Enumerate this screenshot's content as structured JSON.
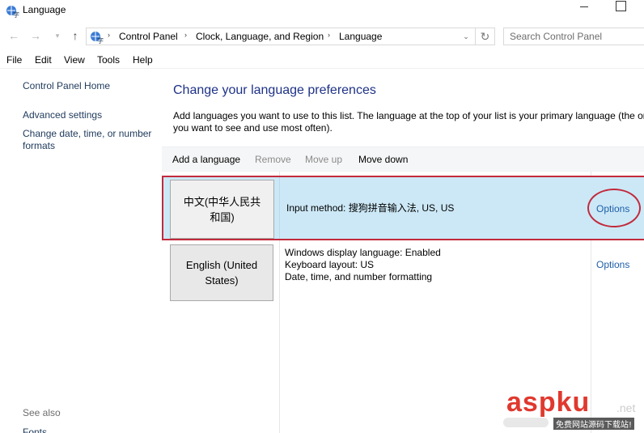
{
  "window": {
    "title": "Language"
  },
  "nav": {
    "back": "←",
    "forward": "→",
    "recent": "▾",
    "up": "↑",
    "breadcrumbs": [
      "Control Panel",
      "Clock, Language, and Region",
      "Language"
    ],
    "separator": "›",
    "dropdown": "⌄",
    "refresh": "↻",
    "search_placeholder": "Search Control Panel"
  },
  "menu": [
    "File",
    "Edit",
    "View",
    "Tools",
    "Help"
  ],
  "sidebar": {
    "home": "Control Panel Home",
    "advanced": "Advanced settings",
    "datetime_line1": "Change date, time, or number",
    "datetime_line2": "formats",
    "see_also": "See also",
    "fonts": "Fonts"
  },
  "main": {
    "heading": "Change your language preferences",
    "desc_line1": "Add languages you want to use to this list. The language at the top of your list is your primary language (the one",
    "desc_line2": "you want to see and use most often)."
  },
  "toolbar": {
    "add": "Add a language",
    "remove": "Remove",
    "move_up": "Move up",
    "move_down": "Move down"
  },
  "languages": [
    {
      "name_line1": "中文(中华人民共",
      "name_line2": "和国)",
      "info": [
        "Input method: 搜狗拼音输入法, US, US"
      ],
      "options": "Options",
      "selected": true
    },
    {
      "name_line1": "English (United",
      "name_line2": "States)",
      "info": [
        "Windows display language: Enabled",
        "Keyboard layout: US",
        "Date, time, and number formatting"
      ],
      "options": "Options",
      "selected": false
    }
  ],
  "watermark": {
    "brand": "aspku",
    "suffix": ".net",
    "tagline": "免费网站源码下载站!"
  },
  "colors": {
    "selected_row": "#cce8f6",
    "highlight_border": "#c22a3c",
    "link": "#1e5fa8",
    "heading": "#1e3287"
  }
}
